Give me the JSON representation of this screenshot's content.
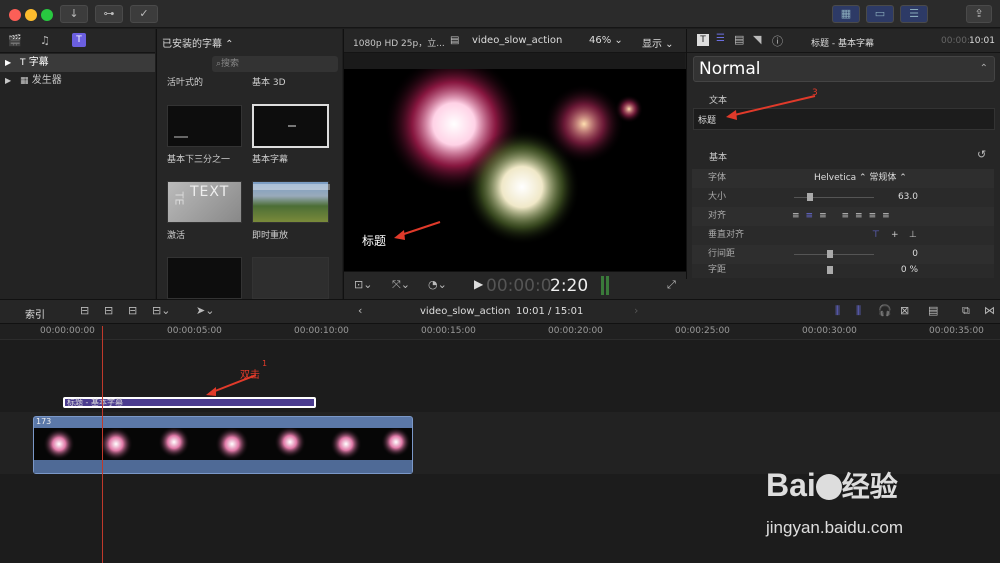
{
  "toolbar": {
    "download": "↓",
    "keys": "⊶",
    "check": "✓",
    "share": "⇪"
  },
  "library": {
    "items": [
      {
        "label": "字幕"
      },
      {
        "label": "发生器"
      }
    ]
  },
  "browser": {
    "header": "已安装的字幕 ⌃",
    "search_placeholder": "搜索",
    "top_labels": [
      "活叶式的",
      "基本 3D"
    ],
    "thumbs": [
      {
        "label": "基本下三分之一"
      },
      {
        "label": "基本字幕"
      },
      {
        "label": "激活"
      },
      {
        "label": "即时重放"
      }
    ]
  },
  "viewer": {
    "format": "1080p HD 25p，立...",
    "clip": "video_slow_action",
    "zoom": "46% ⌄",
    "view": "显示 ⌄",
    "title_overlay": "标题",
    "timecode_dim": "00:00:0",
    "timecode": "2:20"
  },
  "inspector": {
    "title": "标题 - 基本字幕",
    "duration_dim": "00:00:",
    "duration": "10:01",
    "preset": "Normal",
    "text_section": "文本",
    "text_value": "标题",
    "basic_section": "基本",
    "rows": [
      {
        "label": "字体",
        "value": "Helvetica ⌃   常规体 ⌃"
      },
      {
        "label": "大小",
        "value": "63.0"
      },
      {
        "label": "对齐",
        "value": ""
      },
      {
        "label": "垂直对齐",
        "value": ""
      },
      {
        "label": "行间距",
        "value": "0"
      },
      {
        "label": "字距",
        "value": "0 %"
      }
    ]
  },
  "timeline": {
    "index": "索引",
    "clip_name": "video_slow_action",
    "position": "10:01 / 15:01",
    "ruler": [
      "00:00:00:00",
      "00:00:05:00",
      "00:00:10:00",
      "00:00:15:00",
      "00:00:20:00",
      "00:00:25:00",
      "00:00:30:00",
      "00:00:35:00"
    ],
    "title_clip": "标题 - 基本字幕",
    "video_label": "173"
  },
  "annotations": {
    "a1": "双击",
    "n1": "1",
    "n3": "3"
  },
  "watermark": {
    "brand": "Bai",
    "brand2": "经验",
    "url": "jingyan.baidu.com"
  },
  "colors": {
    "accent": "#6b5fe0",
    "titleclip": "#4b3c8f",
    "videoclip": "#5b78a8",
    "annot": "#e03a2a"
  }
}
